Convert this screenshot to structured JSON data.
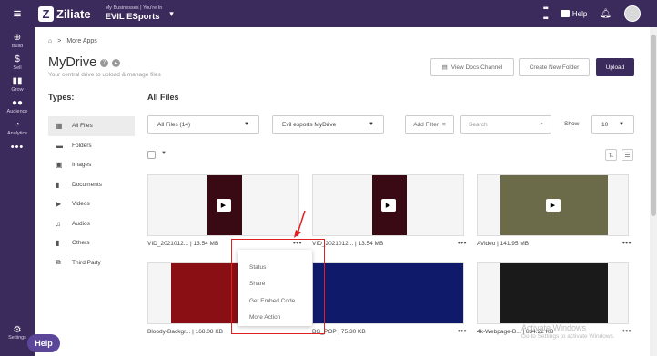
{
  "app": {
    "logo_text": "Ziliate",
    "business_small_label": "My Businesses | You're In",
    "business_name": "EVIL ESports",
    "help_label": "Help"
  },
  "sidebar": {
    "items": [
      {
        "label": "Build",
        "icon": "plus-circle-icon"
      },
      {
        "label": "Sell",
        "icon": "dollar-icon"
      },
      {
        "label": "Grow",
        "icon": "bar-chart-icon"
      },
      {
        "label": "Audience",
        "icon": "people-icon"
      },
      {
        "label": "Analytics",
        "icon": "pie-chart-icon"
      }
    ],
    "more_label": "•••",
    "settings_label": "Settings",
    "help_pill_label": "Help"
  },
  "breadcrumb": {
    "home_icon": "home-icon",
    "separator": ">",
    "current": "More Apps"
  },
  "page": {
    "title": "MyDrive",
    "subtitle": "Your central drive to upload & manage files",
    "view_docs_label": "View Docs Channel",
    "new_folder_label": "Create New Folder",
    "upload_label": "Upload"
  },
  "types": {
    "heading": "Types:",
    "items": [
      {
        "label": "All Files",
        "icon": "grid-icon"
      },
      {
        "label": "Folders",
        "icon": "folder-icon"
      },
      {
        "label": "Images",
        "icon": "image-icon"
      },
      {
        "label": "Documents",
        "icon": "document-icon"
      },
      {
        "label": "Videos",
        "icon": "video-icon"
      },
      {
        "label": "Audios",
        "icon": "music-icon"
      },
      {
        "label": "Others",
        "icon": "file-icon"
      },
      {
        "label": "Third Party",
        "icon": "third-party-icon"
      }
    ]
  },
  "files": {
    "heading": "All Files",
    "filter_value": "All Files (14)",
    "drive_value": "Evil esports MyDrive",
    "add_filter_label": "Add Filter",
    "search_placeholder": "Search",
    "show_label": "Show",
    "show_value": "10",
    "items": [
      {
        "label": "VID_2021012... | 13.54 MB",
        "thumb": "#3a0a14"
      },
      {
        "label": "VID_2021012... | 13.54 MB",
        "thumb": "#3a0a14"
      },
      {
        "label": "AVideo | 141.95 MB",
        "thumb": "#6b6b4a"
      },
      {
        "label": "Bloody-Backgr... | 168.08 KB",
        "thumb": "#8a0f14"
      },
      {
        "label": "BG_POP | 75.30 KB",
        "thumb": "#0f1a6a"
      },
      {
        "label": "4k-Webpage-B... | 834.22 KB",
        "thumb": "#1a1a1a"
      }
    ]
  },
  "context_menu": {
    "items": [
      "Status",
      "Share",
      "Get Embed Code",
      "More Action"
    ]
  },
  "watermark": {
    "line1": "Activate Windows",
    "line2": "Go to Settings to activate Windows."
  }
}
